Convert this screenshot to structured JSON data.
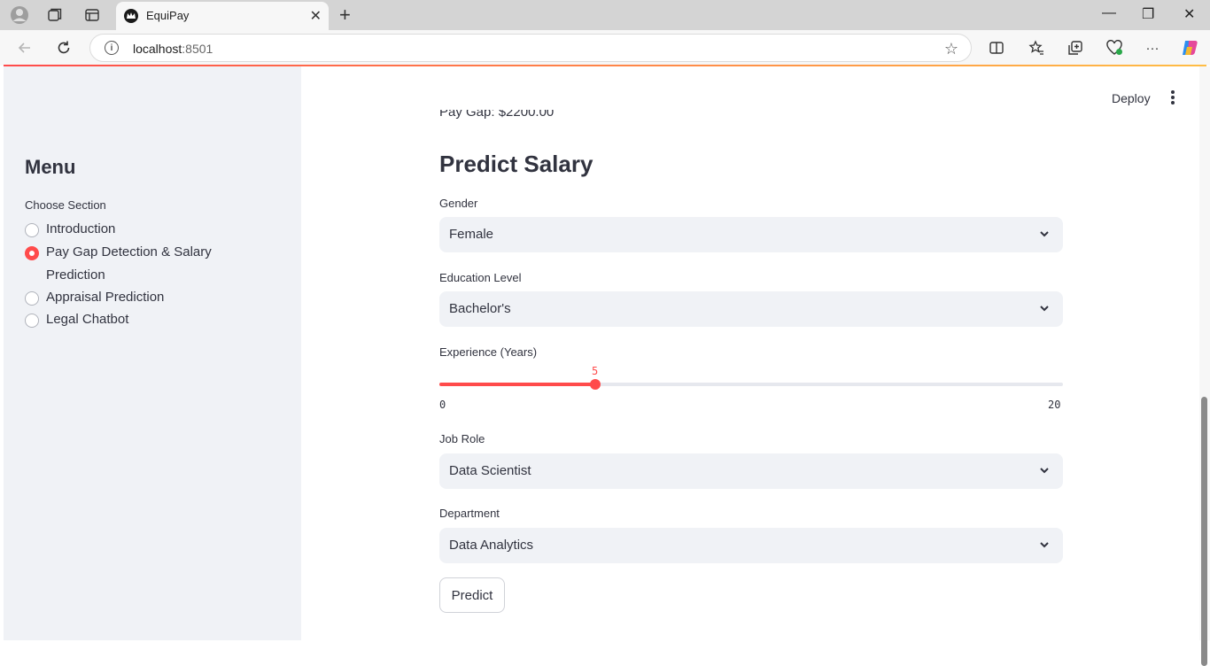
{
  "browser": {
    "tab_title": "EquiPay",
    "url_host": "localhost",
    "url_port": ":8501"
  },
  "header": {
    "deploy_label": "Deploy"
  },
  "sidebar": {
    "title": "Menu",
    "choose_label": "Choose Section",
    "items": [
      {
        "label": "Introduction",
        "selected": false
      },
      {
        "label": "Pay Gap Detection & Salary Prediction",
        "selected": true
      },
      {
        "label": "Appraisal Prediction",
        "selected": false
      },
      {
        "label": "Legal Chatbot",
        "selected": false
      }
    ]
  },
  "main": {
    "partial_text": "Pay Gap: $2200.00",
    "heading": "Predict Salary",
    "gender": {
      "label": "Gender",
      "value": "Female"
    },
    "education": {
      "label": "Education Level",
      "value": "Bachelor's"
    },
    "experience": {
      "label": "Experience (Years)",
      "value": "5",
      "min": "0",
      "max": "20"
    },
    "job_role": {
      "label": "Job Role",
      "value": "Data Scientist"
    },
    "department": {
      "label": "Department",
      "value": "Data Analytics"
    },
    "predict_label": "Predict"
  },
  "colors": {
    "accent": "#ff4b4b",
    "sidebar_bg": "#f0f2f6",
    "text": "#31333f"
  }
}
